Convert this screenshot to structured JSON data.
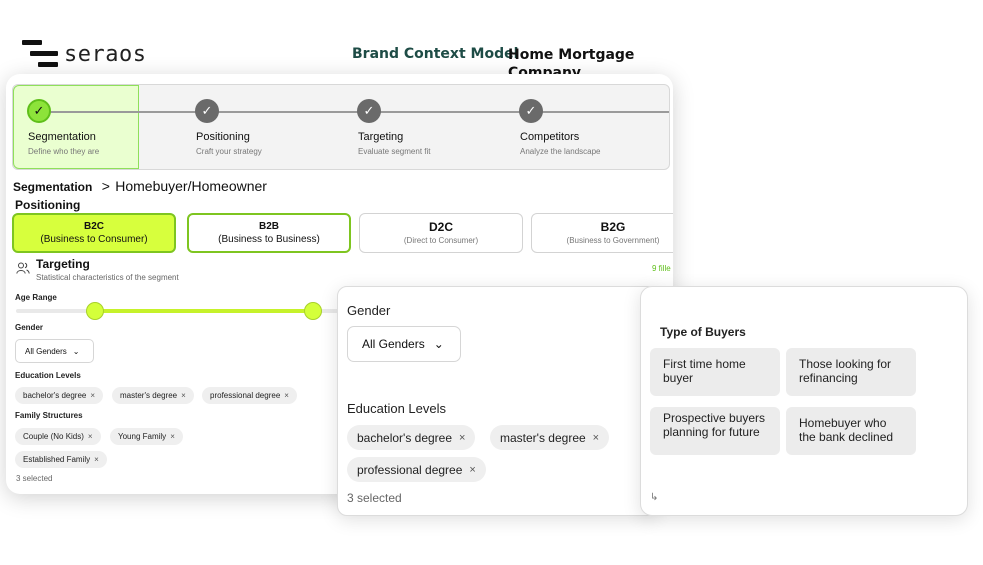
{
  "header": {
    "logo_text": "seraos",
    "model_label": "Brand Context Model",
    "company": "Home Mortgage Company"
  },
  "stepper": {
    "steps": [
      {
        "title": "Segmentation",
        "subtitle": "Define who they are",
        "state": "active"
      },
      {
        "title": "Positioning",
        "subtitle": "Craft your strategy",
        "state": "done"
      },
      {
        "title": "Targeting",
        "subtitle": "Evaluate segment fit",
        "state": "done"
      },
      {
        "title": "Competitors",
        "subtitle": "Analyze the landscape",
        "state": "done"
      }
    ],
    "check_glyph": "✓"
  },
  "breadcrumb": {
    "root": "Segmentation",
    "separator": ">",
    "current": "Homebuyer/Homeowner"
  },
  "positioning": {
    "title": "Positioning",
    "options": [
      {
        "code": "B2C",
        "label": "(Business to Consumer)",
        "selected": true
      },
      {
        "code": "B2B",
        "label": "(Business to Business)",
        "selected": false
      },
      {
        "code": "D2C",
        "label": "(Direct to Consumer)",
        "selected": false
      },
      {
        "code": "B2G",
        "label": "(Business to Government)",
        "selected": false
      }
    ]
  },
  "targeting": {
    "title": "Targeting",
    "subtitle": "Statistical characteristics of the segment",
    "filled_text": "9 fille",
    "icon": "users-icon",
    "age_range_label": "Age Range",
    "gender_label": "Gender",
    "gender_value": "All Genders",
    "education_label": "Education Levels",
    "education_chips": [
      "bachelor's degree",
      "master's degree",
      "professional degree"
    ],
    "family_label": "Family Structures",
    "family_chips": [
      "Couple (No Kids)",
      "Young Family",
      "Established Family"
    ],
    "family_count": "3 selected",
    "remove_glyph": "×",
    "chevron_glyph": "⌄"
  },
  "gender_panel": {
    "gender_label": "Gender",
    "gender_value": "All Genders",
    "education_label": "Education Levels",
    "education_chips": [
      "bachelor's degree",
      "master's degree",
      "professional degree"
    ],
    "education_count": "3 selected"
  },
  "buyers_panel": {
    "title": "Type of Buyers",
    "buyers": [
      "First time home buyer",
      "Those looking for refinancing",
      "Prospective buyers planning for future",
      "Homebuyer who the bank declined"
    ],
    "footer_glyph": "↳"
  },
  "colors": {
    "accent_lime": "#d7ff3d",
    "accent_green": "#8de33a",
    "brand_teal": "#1e4c46"
  }
}
